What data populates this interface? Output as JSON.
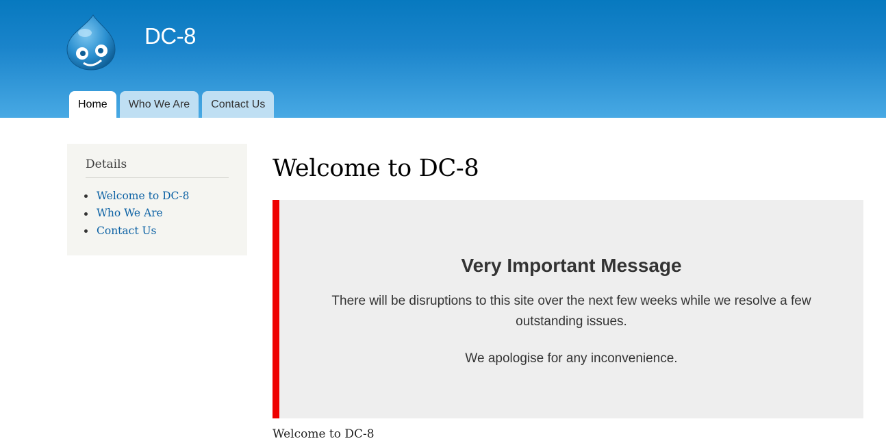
{
  "site": {
    "name": "DC-8",
    "logo_icon": "drupal-drop-logo-icon",
    "header_color_top": "#0779bf",
    "header_color_bottom": "#48a9e4"
  },
  "tabs": [
    {
      "label": "Home",
      "active": true
    },
    {
      "label": "Who We Are",
      "active": false
    },
    {
      "label": "Contact Us",
      "active": false
    }
  ],
  "sidebar": {
    "title": "Details",
    "links": [
      "Welcome to DC-8",
      "Who We Are",
      "Contact Us"
    ]
  },
  "main": {
    "title": "Welcome to DC-8",
    "notice": {
      "heading": "Very Important Message",
      "text": "There will be disruptions to this site over the next few weeks while we resolve a few outstanding issues.",
      "apology": "We apologise for any inconvenience.",
      "accent_color": "#ee0000"
    },
    "body_text": "Welcome to DC-8"
  }
}
